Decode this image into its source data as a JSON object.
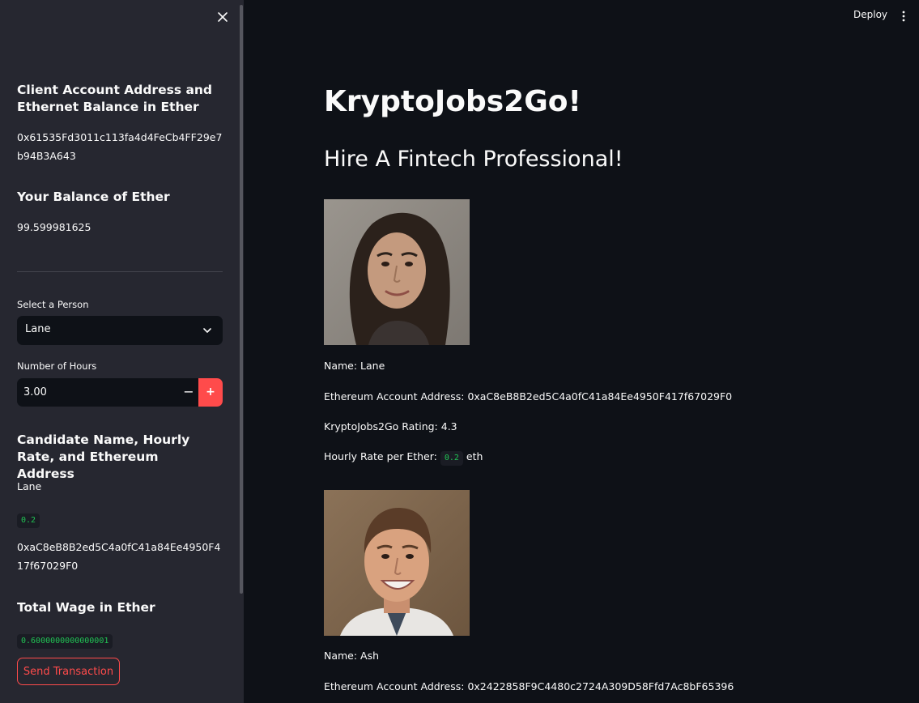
{
  "sidebar": {
    "client_heading": "Client Account Address and Ethernet Balance in Ether",
    "client_address": "0x61535Fd3011c113fa4d4FeCb4FF29e7b94B3A643",
    "balance_heading": "Your Balance of Ether",
    "balance_value": "99.599981625",
    "select_label": "Select a Person",
    "select_value": "Lane",
    "hours_label": "Number of Hours",
    "hours_value": "3.00",
    "minus_label": "−",
    "plus_label": "+",
    "candidate_heading": "Candidate Name, Hourly Rate, and Ethereum Address",
    "candidate_name": "Lane",
    "candidate_rate": "0.2",
    "candidate_address": "0xaC8eB8B2ed5C4a0fC41a84Ee4950F417f67029F0",
    "wage_heading": "Total Wage in Ether",
    "wage_value": "0.6000000000000001",
    "send_button": "Send Transaction"
  },
  "header": {
    "deploy_label": "Deploy",
    "menu_icon": "vertical-ellipsis-icon",
    "close_icon": "close-icon"
  },
  "main": {
    "title": "KryptoJobs2Go!",
    "subtitle": "Hire A Fintech Professional!",
    "candidates": [
      {
        "name_line": "Name: Lane",
        "address_line": "Ethereum Account Address: 0xaC8eB8B2ed5C4a0fC41a84Ee4950F417f67029F0",
        "rating_line": "KryptoJobs2Go Rating: 4.3",
        "rate_prefix": "Hourly Rate per Ether:",
        "rate_value": "0.2",
        "rate_suffix": "eth"
      },
      {
        "name_line": "Name: Ash",
        "address_line": "Ethereum Account Address: 0x2422858F9C4480c2724A309D58Ffd7Ac8bF65396"
      }
    ]
  },
  "colors": {
    "accent": "#ff4b4b",
    "code_green": "#21c354",
    "sidebar_bg": "#262730",
    "main_bg": "#0e1117"
  }
}
